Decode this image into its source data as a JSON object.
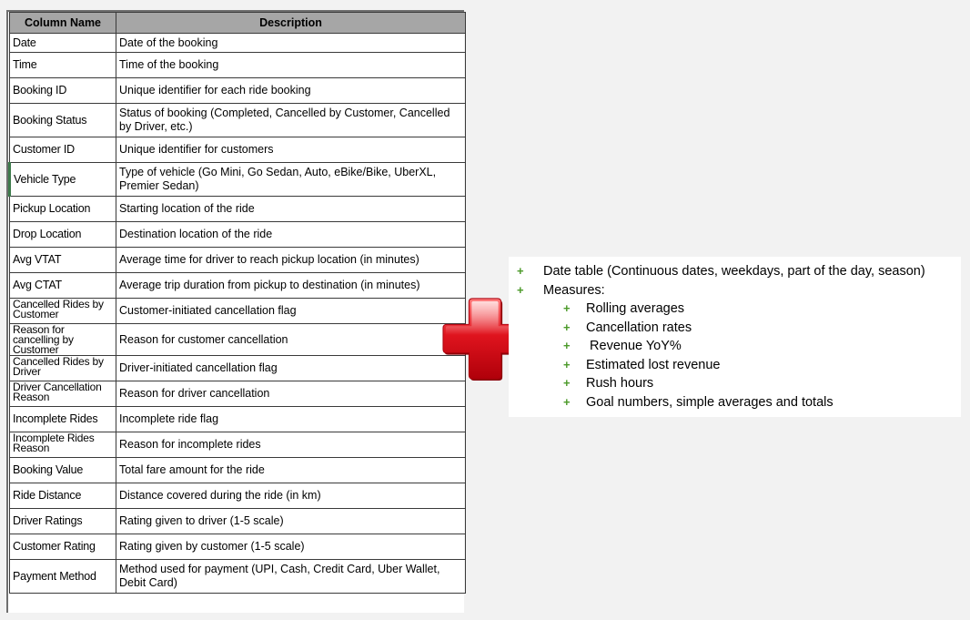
{
  "table": {
    "headers": {
      "column_name": "Column Name",
      "description": "Description"
    },
    "rows": [
      {
        "name": "Date",
        "desc": "Date of the booking"
      },
      {
        "name": "Time",
        "desc": "Time of the booking"
      },
      {
        "name": "Booking ID",
        "desc": "Unique identifier for each ride booking"
      },
      {
        "name": "Booking Status",
        "desc": "Status of booking (Completed, Cancelled by Customer, Cancelled by Driver, etc.)"
      },
      {
        "name": "Customer ID",
        "desc": "Unique identifier for customers"
      },
      {
        "name": "Vehicle Type",
        "desc": "Type of vehicle (Go Mini, Go Sedan, Auto, eBike/Bike, UberXL, Premier Sedan)"
      },
      {
        "name": "Pickup Location",
        "desc": "Starting location of the ride"
      },
      {
        "name": "Drop Location",
        "desc": "Destination location of the ride"
      },
      {
        "name": "Avg VTAT",
        "desc": "Average time for driver to reach pickup location (in minutes)"
      },
      {
        "name": "Avg CTAT",
        "desc": "Average trip duration from pickup to destination (in minutes)"
      },
      {
        "name": "Cancelled Rides by Customer",
        "desc": "Customer-initiated cancellation flag"
      },
      {
        "name": "Reason for cancelling by Customer",
        "desc": "Reason for customer cancellation"
      },
      {
        "name": "Cancelled Rides by Driver",
        "desc": "Driver-initiated cancellation flag"
      },
      {
        "name": "Driver Cancellation Reason",
        "desc": "Reason for driver cancellation"
      },
      {
        "name": "Incomplete Rides",
        "desc": "Incomplete ride flag"
      },
      {
        "name": "Incomplete Rides Reason",
        "desc": "Reason for incomplete rides"
      },
      {
        "name": "Booking Value",
        "desc": "Total fare amount for the ride"
      },
      {
        "name": "Ride Distance",
        "desc": "Distance covered during the ride (in km)"
      },
      {
        "name": "Driver Ratings",
        "desc": "Rating given to driver (1-5 scale)"
      },
      {
        "name": "Customer Rating",
        "desc": "Rating given by customer (1-5 scale)"
      },
      {
        "name": "Payment Method",
        "desc": "Method used for payment (UPI, Cash, Credit Card, Uber Wallet, Debit Card)"
      }
    ]
  },
  "plus_graphic": {
    "icon": "red-plus-icon",
    "color": "#e0141e"
  },
  "notes": {
    "bullet_glyph": "+",
    "bullet_color": "#4c9a2a",
    "items": [
      {
        "text": "Date table (Continuous dates, weekdays, part of the day, season)",
        "level": 1
      },
      {
        "text": "Measures:",
        "level": 1
      },
      {
        "text": "Rolling averages",
        "level": 2
      },
      {
        "text": "Cancellation rates",
        "level": 2
      },
      {
        "text": " Revenue YoY%",
        "level": 2
      },
      {
        "text": "Estimated lost revenue",
        "level": 2
      },
      {
        "text": "Rush hours",
        "level": 2
      },
      {
        "text": "Goal numbers, simple averages and totals",
        "level": 2
      }
    ]
  }
}
